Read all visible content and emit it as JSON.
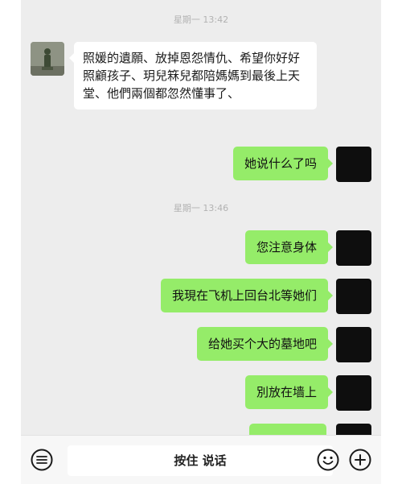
{
  "chat": {
    "timestamps": [
      "星期一 13:42",
      "星期一 13:46"
    ],
    "incoming": {
      "text": "照媛的遺願、放掉恩怨情仇、希望你好好照顧孩子、玥兒箖兒都陪媽媽到最後上天堂、他們兩個都忽然懂事了、"
    },
    "outgoing": [
      "她说什么了吗",
      "您注意身体",
      "我現在飞机上回台北等她们",
      "给她买个大的墓地吧",
      "別放在墙上"
    ]
  },
  "input_bar": {
    "hold_to_talk": "按住 说话",
    "icons": [
      "voice-icon",
      "emoji-icon",
      "plus-icon"
    ]
  },
  "colors": {
    "background": "#ededed",
    "outgoing_bubble": "#95ec69",
    "incoming_bubble": "#ffffff",
    "bottom_bar": "#f7f7f7"
  }
}
